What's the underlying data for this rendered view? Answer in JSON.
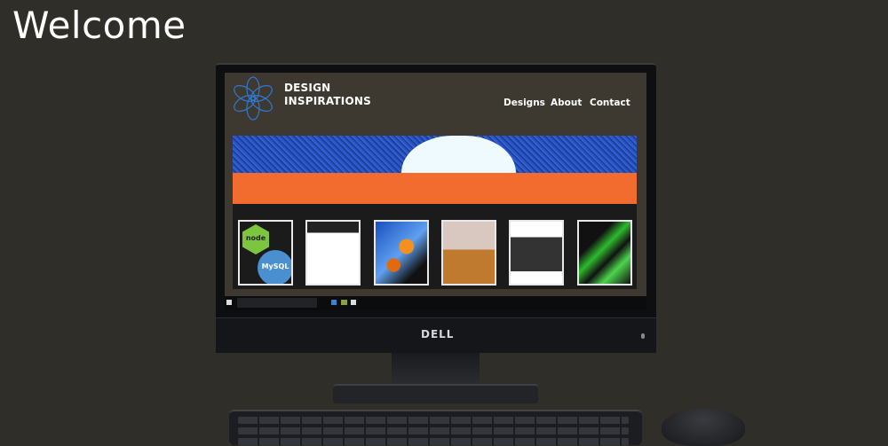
{
  "banner": {
    "title": "Welcome"
  },
  "website": {
    "title_line1": "DESIGN",
    "title_line2": "INSPIRATIONS",
    "nav": [
      "Designs",
      "About",
      "Contact"
    ],
    "thumbnails": [
      {
        "label": "node",
        "label2": "MySQL"
      },
      {
        "label": ""
      },
      {
        "label": ""
      },
      {
        "label": ""
      },
      {
        "label": ""
      },
      {
        "label": ""
      }
    ]
  },
  "monitor": {
    "brand": "DELL"
  },
  "colors": {
    "background": "#2f2e29",
    "hero_orange": "#f26c30",
    "hero_blue": "#2a55c8"
  }
}
